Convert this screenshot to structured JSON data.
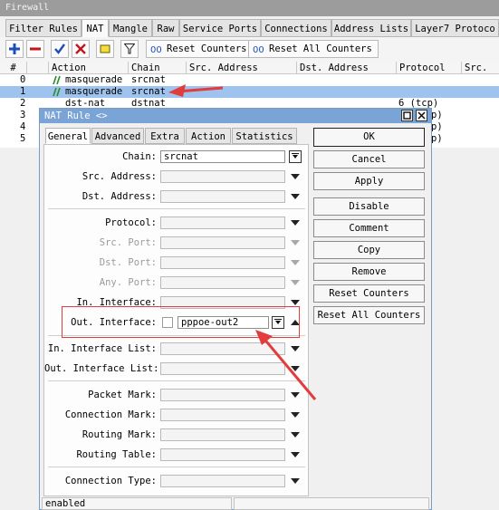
{
  "firewall": {
    "title": "Firewall",
    "tabs": [
      "Filter Rules",
      "NAT",
      "Mangle",
      "Raw",
      "Service Ports",
      "Connections",
      "Address Lists",
      "Layer7 Protoco"
    ],
    "active_tab": "NAT",
    "toolbar": {
      "reset_counters": "Reset Counters",
      "reset_all_counters": "Reset All Counters"
    },
    "columns": [
      "#",
      "Action",
      "Chain",
      "Src. Address",
      "Dst. Address",
      "Protocol",
      "Src."
    ],
    "rows": [
      {
        "num": "0",
        "action": "masquerade",
        "chain": "srcnat",
        "protocol": ""
      },
      {
        "num": "1",
        "action": "masquerade",
        "chain": "srcnat",
        "protocol": ""
      },
      {
        "num": "2",
        "action": "dst-nat",
        "chain": "dstnat",
        "protocol": "6 (tcp)"
      },
      {
        "num": "3",
        "action": "",
        "chain": "",
        "protocol": "p)"
      },
      {
        "num": "4",
        "action": "",
        "chain": "",
        "protocol": "p)"
      },
      {
        "num": "5",
        "action": "",
        "chain": "",
        "protocol": "p)"
      }
    ],
    "selected_row": 1
  },
  "dialog": {
    "title": "NAT Rule <>",
    "tabs": [
      "General",
      "Advanced",
      "Extra",
      "Action",
      "Statistics"
    ],
    "active_tab": "General",
    "fields": {
      "chain": {
        "label": "Chain:",
        "value": "srcnat"
      },
      "src_address": {
        "label": "Src. Address:"
      },
      "dst_address": {
        "label": "Dst. Address:"
      },
      "protocol": {
        "label": "Protocol:"
      },
      "src_port": {
        "label": "Src. Port:"
      },
      "dst_port": {
        "label": "Dst. Port:"
      },
      "any_port": {
        "label": "Any. Port:"
      },
      "in_interface": {
        "label": "In. Interface:"
      },
      "out_interface": {
        "label": "Out. Interface:",
        "value": "pppoe-out2"
      },
      "in_interface_list": {
        "label": "In. Interface List:"
      },
      "out_interface_list": {
        "label": "Out. Interface List:"
      },
      "packet_mark": {
        "label": "Packet Mark:"
      },
      "connection_mark": {
        "label": "Connection Mark:"
      },
      "routing_mark": {
        "label": "Routing Mark:"
      },
      "routing_table": {
        "label": "Routing Table:"
      },
      "connection_type": {
        "label": "Connection Type:"
      }
    },
    "buttons": {
      "ok": "OK",
      "cancel": "Cancel",
      "apply": "Apply",
      "disable": "Disable",
      "comment": "Comment",
      "copy": "Copy",
      "remove": "Remove",
      "reset_counters": "Reset Counters",
      "reset_all_counters": "Reset All Counters"
    },
    "status": "enabled"
  },
  "colors": {
    "selection": "#9ec3ee",
    "dialog_title": "#7aa3d6",
    "annotation": "#e23c3c"
  }
}
